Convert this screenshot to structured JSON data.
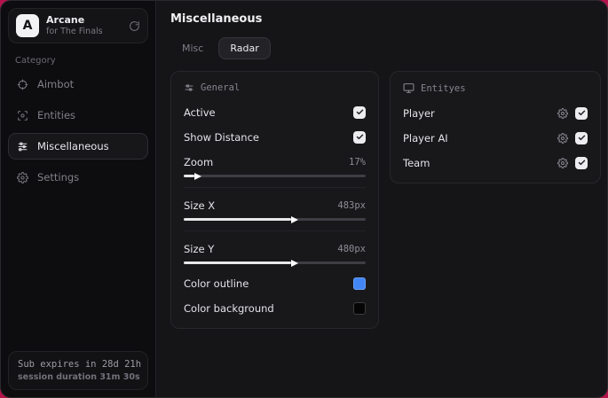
{
  "window": {
    "backdrop_color": "#b3134b"
  },
  "sidebar": {
    "app": {
      "logo_letter": "A",
      "title": "Arcane",
      "subtitle": "for The Finals"
    },
    "category_label": "Category",
    "items": [
      {
        "label": "Aimbot"
      },
      {
        "label": "Entities"
      },
      {
        "label": "Miscellaneous"
      },
      {
        "label": "Settings"
      }
    ],
    "footer": {
      "line1": "Sub expires in 28d 21h",
      "line2": "session duration 31m 30s"
    }
  },
  "main": {
    "title": "Miscellaneous",
    "tabs": [
      {
        "label": "Misc"
      },
      {
        "label": "Radar"
      }
    ],
    "panels": {
      "general": {
        "title": "General",
        "rows": {
          "active": {
            "label": "Active",
            "checked": true
          },
          "show_distance": {
            "label": "Show Distance",
            "checked": true
          },
          "zoom": {
            "label": "Zoom",
            "value": "17%",
            "thumb_percent": 6
          },
          "size_x": {
            "label": "Size X",
            "value": "483px",
            "thumb_percent": 59
          },
          "size_y": {
            "label": "Size Y",
            "value": "480px",
            "thumb_percent": 59
          },
          "color_outline": {
            "label": "Color outline",
            "color": "#4285f4"
          },
          "color_background": {
            "label": "Color background",
            "color": "#050505"
          }
        }
      },
      "entities": {
        "title": "Entityes",
        "rows": [
          {
            "label": "Player",
            "checked": true
          },
          {
            "label": "Player AI",
            "checked": true
          },
          {
            "label": "Team",
            "checked": true
          }
        ]
      }
    }
  }
}
